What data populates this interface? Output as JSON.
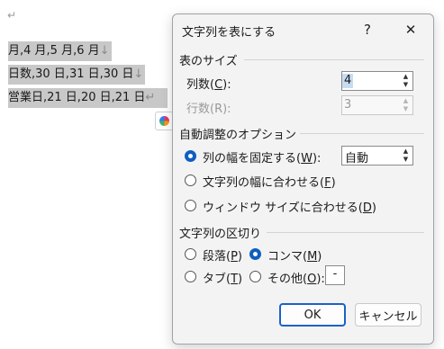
{
  "document": {
    "empty_para_mark": "↵",
    "lines": [
      {
        "text": "月,4 月,5 月,6 月",
        "mark": "↓"
      },
      {
        "text": "日数,30 日,31 日,30 日",
        "mark": "↓"
      },
      {
        "text": "営業日,21 日,20 日,21 日",
        "mark": "↵"
      }
    ]
  },
  "dialog": {
    "title": "文字列を表にする",
    "help_label": "?",
    "close_label": "✕",
    "table_size": {
      "heading": "表のサイズ",
      "columns_label": "列数(",
      "columns_key": "C",
      "columns_label_end": "):",
      "columns_value": "4",
      "rows_label": "行数(R):",
      "rows_value": "3"
    },
    "autofit": {
      "heading": "自動調整のオプション",
      "fixed_label": "列の幅を固定する(",
      "fixed_key": "W",
      "fixed_end": "):",
      "fixed_value": "自動",
      "content_label": "文字列の幅に合わせる(",
      "content_key": "F",
      "content_end": ")",
      "window_label": "ウィンドウ サイズに合わせる(",
      "window_key": "D",
      "window_end": ")"
    },
    "separator": {
      "heading": "文字列の区切り",
      "paragraph_label": "段落(",
      "paragraph_key": "P",
      "paragraph_end": ")",
      "comma_label": "コンマ(",
      "comma_key": "M",
      "comma_end": ")",
      "tab_label": "タブ(",
      "tab_key": "T",
      "tab_end": ")",
      "other_label": "その他(",
      "other_key": "O",
      "other_end": "):",
      "other_value": "-"
    },
    "ok_label": "OK",
    "cancel_label": "キャンセル"
  },
  "colors": {
    "accent": "#0f5fbf",
    "selection": "#c8c8c8",
    "dialog_bg": "#f3f3f3"
  }
}
